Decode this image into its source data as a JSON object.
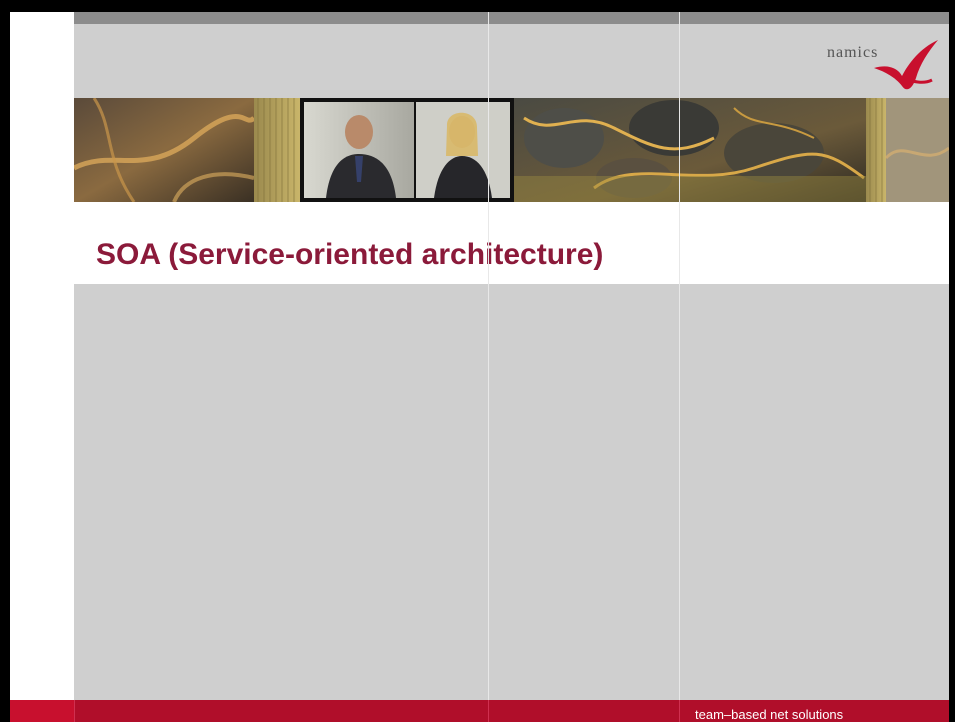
{
  "slide": {
    "title": "SOA (Service-oriented architecture)",
    "logo_text": "namics",
    "tagline": "team–based net solutions"
  },
  "icons": {
    "logo_mark": "namics-swoosh-logo-icon"
  },
  "colors": {
    "title": "#8b1a3a",
    "footer": "#c8102e",
    "panel": "#cfcfcf"
  }
}
